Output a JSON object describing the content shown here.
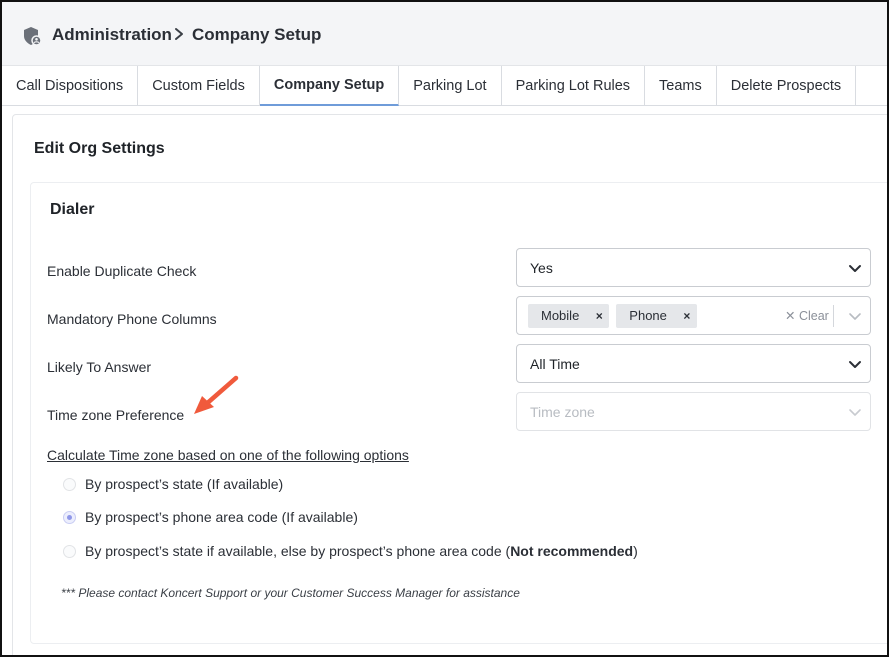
{
  "breadcrumb": {
    "root": "Administration",
    "current": "Company Setup"
  },
  "tabs": [
    {
      "label": "Call Dispositions",
      "active": false
    },
    {
      "label": "Custom Fields",
      "active": false
    },
    {
      "label": "Company Setup",
      "active": true
    },
    {
      "label": "Parking Lot",
      "active": false
    },
    {
      "label": "Parking Lot Rules",
      "active": false
    },
    {
      "label": "Teams",
      "active": false
    },
    {
      "label": "Delete Prospects",
      "active": false
    }
  ],
  "page": {
    "title": "Edit Org Settings"
  },
  "dialer": {
    "title": "Dialer",
    "fields": {
      "duplicate_check": {
        "label": "Enable Duplicate Check",
        "value": "Yes"
      },
      "phone_columns": {
        "label": "Mandatory Phone Columns",
        "tags": [
          "Mobile",
          "Phone"
        ],
        "remove_glyph": "×",
        "clear_label": "✕ Clear"
      },
      "likely_to_answer": {
        "label": "Likely To Answer",
        "value": "All Time"
      },
      "timezone": {
        "label": "Time zone Preference",
        "placeholder": "Time zone"
      }
    },
    "calc_title": "Calculate Time zone based on one of the following options",
    "options": [
      {
        "label": "By prospect’s state (If available)",
        "checked": false
      },
      {
        "label": "By prospect’s phone area code (If available)",
        "checked": true
      },
      {
        "label_prefix": "By prospect’s state if available, else by prospect’s phone area code (",
        "label_bold": "Not recommended",
        "label_suffix": ")",
        "checked": false
      }
    ],
    "note": "*** Please contact Koncert Support or your Customer Success Manager for assistance"
  },
  "colors": {
    "accent_tab_underline": "#6f9cd9",
    "arrow": "#f05a3c",
    "radio_checked": "#8f97e8"
  },
  "icons": {
    "breadcrumb_root": "shield-icon",
    "separator": "chevron-right-icon",
    "select": "chevron-down-icon",
    "annotation": "arrow-icon"
  }
}
